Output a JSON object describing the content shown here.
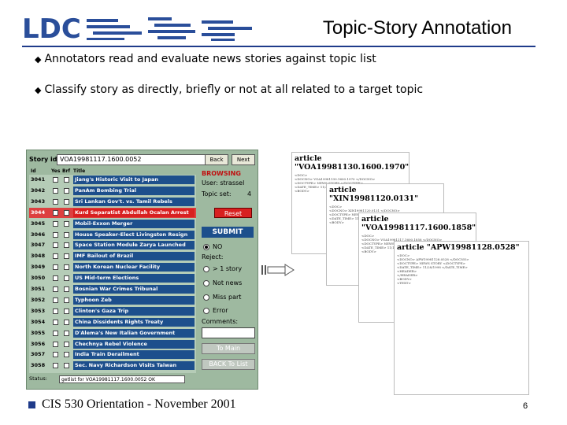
{
  "slide": {
    "title": "Topic-Story Annotation",
    "logo_text": "LDC",
    "bullets": [
      "Annotators read and evaluate news stories against topic list",
      "Classify story as directly, briefly or not at all related to a target topic"
    ],
    "footer": "CIS 530 Orientation - November 2001",
    "page_number": "6",
    "accent_color": "#1f3b8a"
  },
  "app": {
    "story_id_label": "Story id",
    "story_id_value": "VOA19981117.1600.0052",
    "back_label": "Back",
    "next_label": "Next",
    "columns": {
      "id": "Id",
      "yes": "Yes",
      "brf": "Brf",
      "title": "Title"
    },
    "rows": [
      {
        "id": "3041",
        "title": "Jiang's Historic Visit to Japan",
        "selected": false
      },
      {
        "id": "3042",
        "title": "PanAm Bombing Trial",
        "selected": false
      },
      {
        "id": "3043",
        "title": "Sri Lankan Gov't. vs. Tamil Rebels",
        "selected": false
      },
      {
        "id": "3044",
        "title": "Kurd Separatist Abdullah Ocalan Arrest",
        "selected": true
      },
      {
        "id": "3045",
        "title": "Mobil-Exxon Merger",
        "selected": false
      },
      {
        "id": "3046",
        "title": "House Speaker-Elect Livingston Resign",
        "selected": false
      },
      {
        "id": "3047",
        "title": "Space Station Module Zarya Launched",
        "selected": false
      },
      {
        "id": "3048",
        "title": "IMF Bailout of Brazil",
        "selected": false
      },
      {
        "id": "3049",
        "title": "North Korean Nuclear Facility",
        "selected": false
      },
      {
        "id": "3050",
        "title": "US Mid-term Elections",
        "selected": false
      },
      {
        "id": "3051",
        "title": "Bosnian War Crimes Tribunal",
        "selected": false
      },
      {
        "id": "3052",
        "title": "Typhoon Zeb",
        "selected": false
      },
      {
        "id": "3053",
        "title": "Clinton's Gaza Trip",
        "selected": false
      },
      {
        "id": "3054",
        "title": "China Dissidents Rights Treaty",
        "selected": false
      },
      {
        "id": "3055",
        "title": "D'Alema's New Italian Government",
        "selected": false
      },
      {
        "id": "3056",
        "title": "Chechnya Rebel Violence",
        "selected": false
      },
      {
        "id": "3057",
        "title": "India Train Derailment",
        "selected": false
      },
      {
        "id": "3058",
        "title": "Sec. Navy Richardson Visits Taiwan",
        "selected": false
      }
    ],
    "browsing_label": "BROWSING",
    "user_label": "User: strassel",
    "topic_set_label": "Topic set:",
    "topic_set_value": "4",
    "reset_label": "Reset",
    "submit_label": "SUBMIT",
    "no_label": "NO",
    "reject_label": "Reject:",
    "reject_options": [
      "> 1 story",
      "Not news",
      "Miss part",
      "Error"
    ],
    "comments_label": "Comments:",
    "to_main_label": "To Main",
    "back_to_list_label": "BACK To List",
    "status_label": "Status:",
    "status_value": "getlist for VOA19981117.1600.0052   OK"
  },
  "articles": [
    {
      "heading": "article \"VOA19981130.1600.1970\""
    },
    {
      "heading": "article \"XIN19981120.0131\""
    },
    {
      "heading": "article \"VOA19981117.1600.1858\""
    },
    {
      "heading": "article \"APW19981128.0528\""
    }
  ]
}
